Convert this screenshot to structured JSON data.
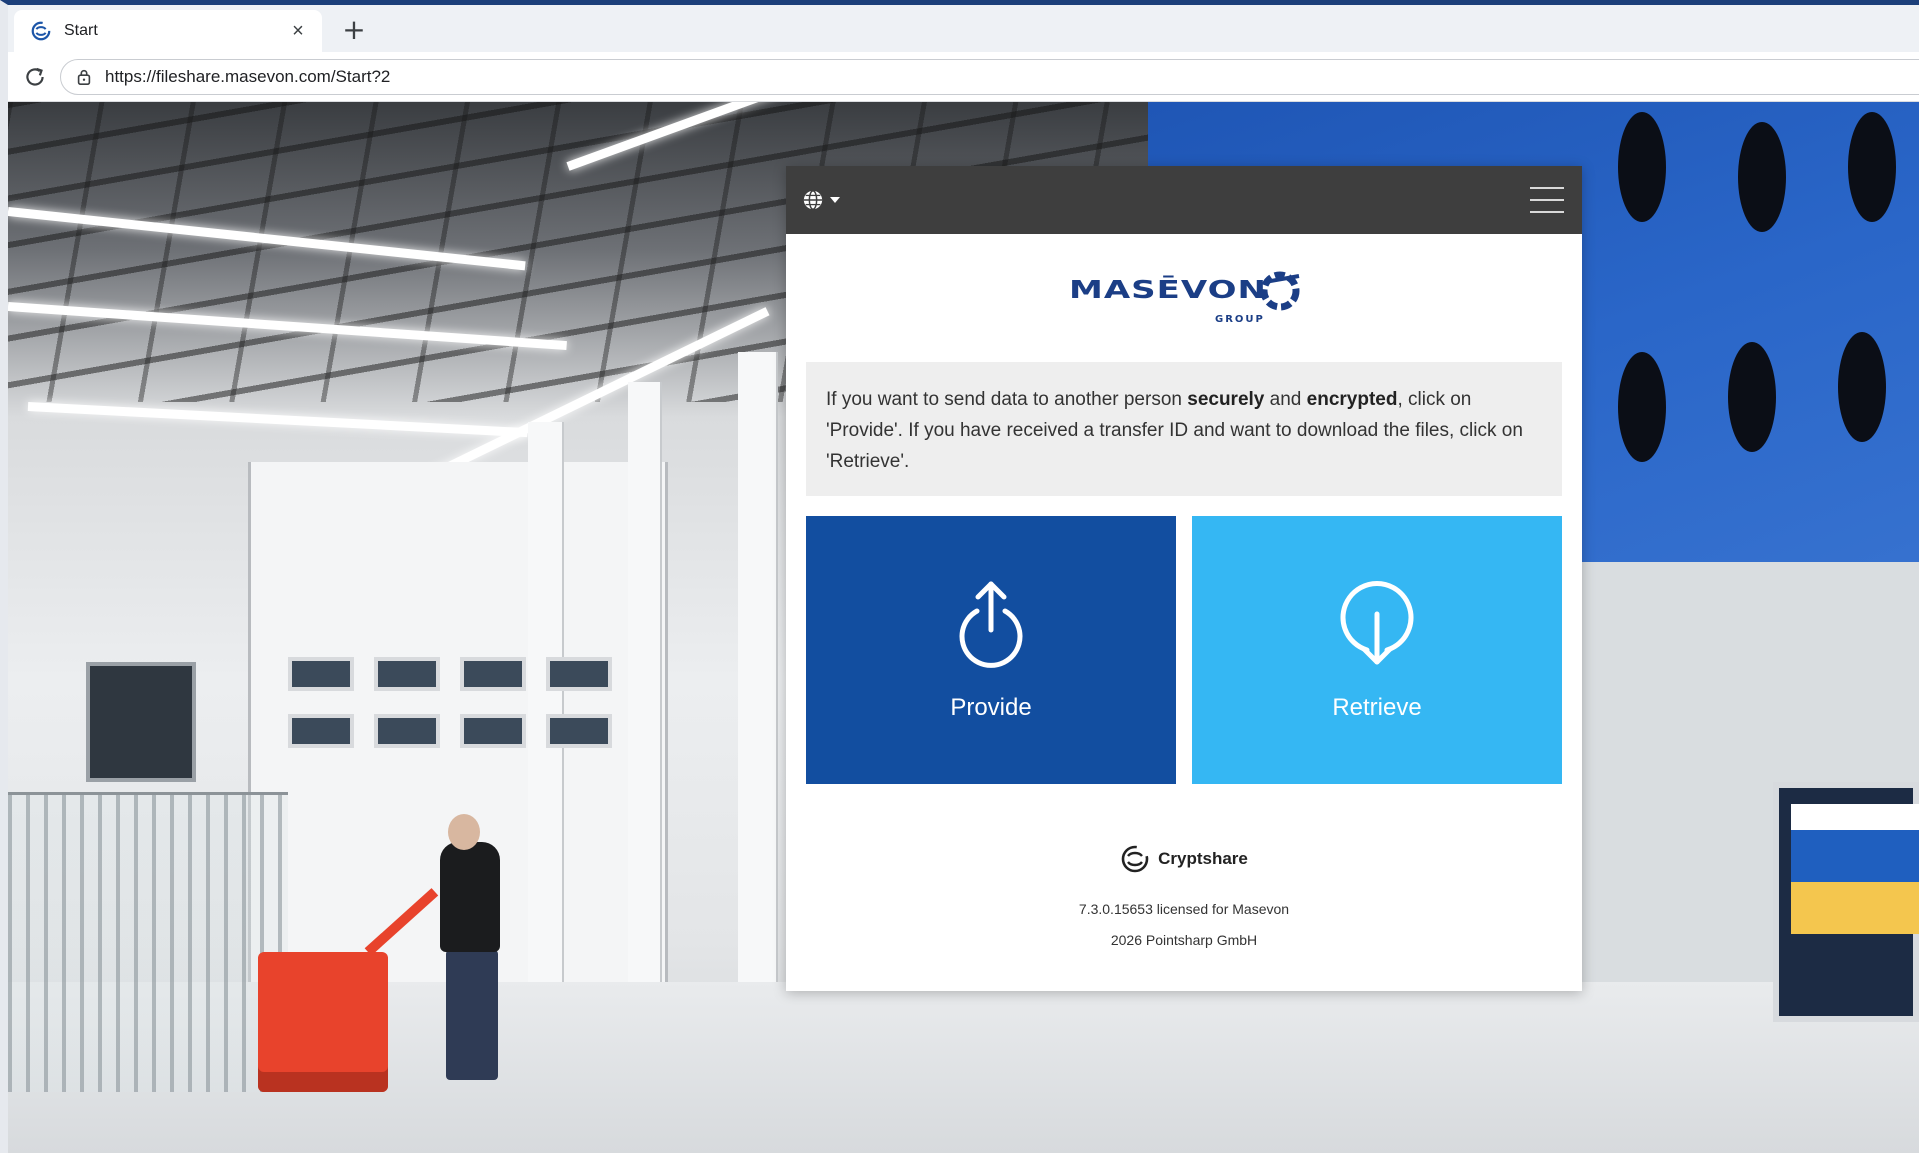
{
  "browser": {
    "tab_title": "Start",
    "tab_close": "×",
    "new_tab": "+",
    "url": "https://fileshare.masevon.com/Start?2"
  },
  "header": {
    "language_icon": "globe-icon",
    "menu_icon": "hamburger-menu-icon"
  },
  "logo": {
    "wordmark": "MASĒVON",
    "subtitle": "GROUP",
    "color": "#1b3e86"
  },
  "intro": {
    "part1": "If you want to send data to another person ",
    "bold1": "securely",
    "part2": " and ",
    "bold2": "encrypted",
    "part3": ", click on 'Provide'. If you have received a transfer ID and want to download the files, click on 'Retrieve'."
  },
  "actions": {
    "provide_label": "Provide",
    "provide_color": "#124ea0",
    "retrieve_label": "Retrieve",
    "retrieve_color": "#35b7f3"
  },
  "footer": {
    "brand": "Cryptshare",
    "version": "7.3.0.15653 licensed for Masevon",
    "copyright": "2026 Pointsharp GmbH"
  }
}
